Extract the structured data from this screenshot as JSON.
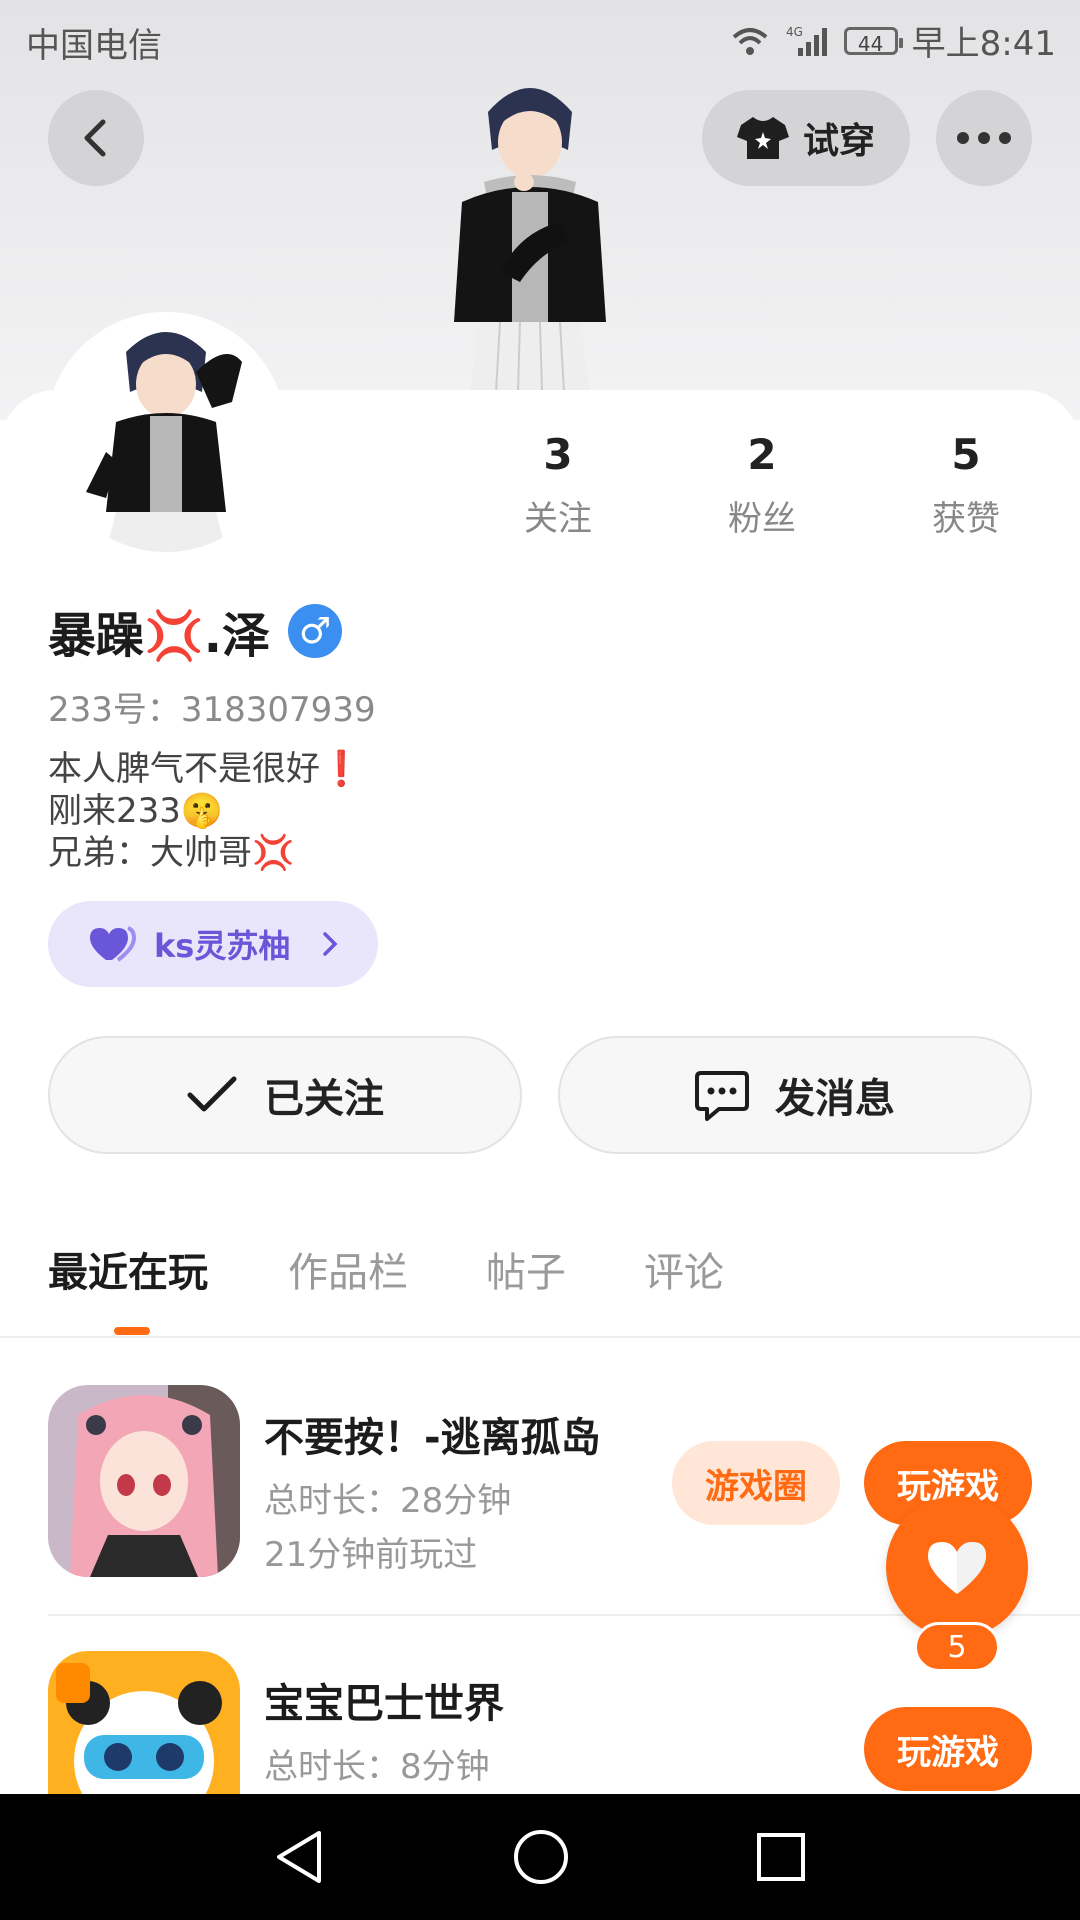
{
  "status_bar": {
    "carrier": "中国电信",
    "network": "4G",
    "battery": "44",
    "time": "早上8:41"
  },
  "header": {
    "back_icon": "chevron-left-icon",
    "try_on_label": "试穿",
    "more_icon": "more-dots-icon"
  },
  "profile": {
    "stats": [
      {
        "value": "3",
        "label": "关注"
      },
      {
        "value": "2",
        "label": "粉丝"
      },
      {
        "value": "5",
        "label": "获赞"
      }
    ],
    "name": "暴躁💢.泽",
    "gender_symbol": "♂",
    "uid": "233号：318307939",
    "bio": [
      "本人脾气不是很好❗",
      "刚来233🤫",
      "兄弟：大帅哥💢"
    ],
    "tag": {
      "label": "ks灵苏柚",
      "icon": "heart-icon"
    }
  },
  "actions": {
    "follow_label": "已关注",
    "message_label": "发消息"
  },
  "tabs": [
    "最近在玩",
    "作品栏",
    "帖子",
    "评论"
  ],
  "active_tab": "最近在玩",
  "games": [
    {
      "title": "不要按！-逃离孤岛",
      "duration": "总时长：28分钟",
      "last_played": "21分钟前玩过",
      "circle_label": "游戏圈",
      "play_label": "玩游戏"
    },
    {
      "title": "宝宝巴士世界",
      "duration": "总时长：8分钟",
      "play_label": "玩游戏"
    }
  ],
  "like_fab": {
    "count": "5",
    "icon": "heart-icon"
  },
  "colors": {
    "accent": "#ff6a13",
    "tag_bg": "#e9e6fb",
    "tag_text": "#6a56d8",
    "gender": "#3a8ff0"
  }
}
